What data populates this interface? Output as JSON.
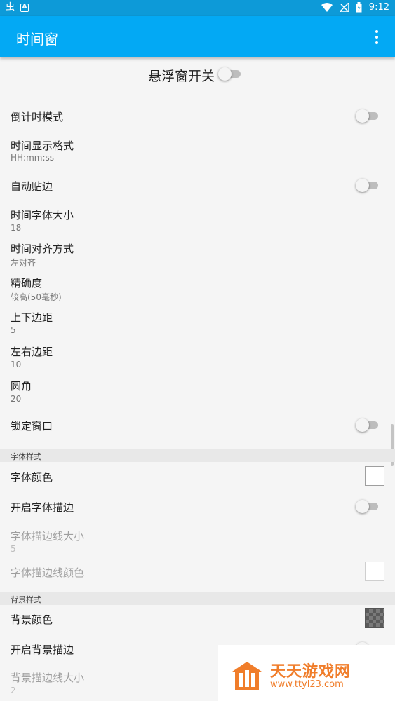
{
  "status_bar": {
    "time": "9:12"
  },
  "app_bar": {
    "title": "时间窗"
  },
  "master_switch": {
    "label": "悬浮窗开关",
    "on": false
  },
  "settings": [
    {
      "title": "倒计时模式",
      "type": "switch",
      "on": false
    },
    {
      "title": "时间显示格式",
      "summary": "HH:mm:ss"
    },
    {
      "title": "自动贴边",
      "type": "switch",
      "on": false
    },
    {
      "title": "时间字体大小",
      "summary": "18"
    },
    {
      "title": "时间对齐方式",
      "summary": "左对齐"
    },
    {
      "title": "精确度",
      "summary": "较高(50毫秒)"
    },
    {
      "title": "上下边距",
      "summary": "5"
    },
    {
      "title": "左右边距",
      "summary": "10"
    },
    {
      "title": "圆角",
      "summary": "20"
    },
    {
      "title": "锁定窗口",
      "type": "switch",
      "on": false
    }
  ],
  "font_section": {
    "header": "字体样式",
    "items": [
      {
        "title": "字体颜色",
        "type": "color",
        "color": "#ffffff"
      },
      {
        "title": "开启字体描边",
        "type": "switch",
        "on": false
      },
      {
        "title": "字体描边线大小",
        "summary": "5",
        "enabled": false
      },
      {
        "title": "字体描边线颜色",
        "type": "color",
        "color": "#ffffff",
        "enabled": false
      }
    ]
  },
  "background_section": {
    "header": "背景样式",
    "items": [
      {
        "title": "背景颜色",
        "type": "color",
        "color": "transparent-checker"
      },
      {
        "title": "开启背景描边",
        "type": "switch",
        "on": false
      },
      {
        "title": "背景描边线大小",
        "summary": "2",
        "enabled": false
      }
    ]
  },
  "watermark": {
    "name": "天天游戏网",
    "url": "www.ttyl23.com"
  },
  "colors": {
    "status_bar": "#0d9ad8",
    "app_bar": "#03a9f4",
    "background": "#f5f5f5",
    "watermark": "#f07d2a"
  }
}
